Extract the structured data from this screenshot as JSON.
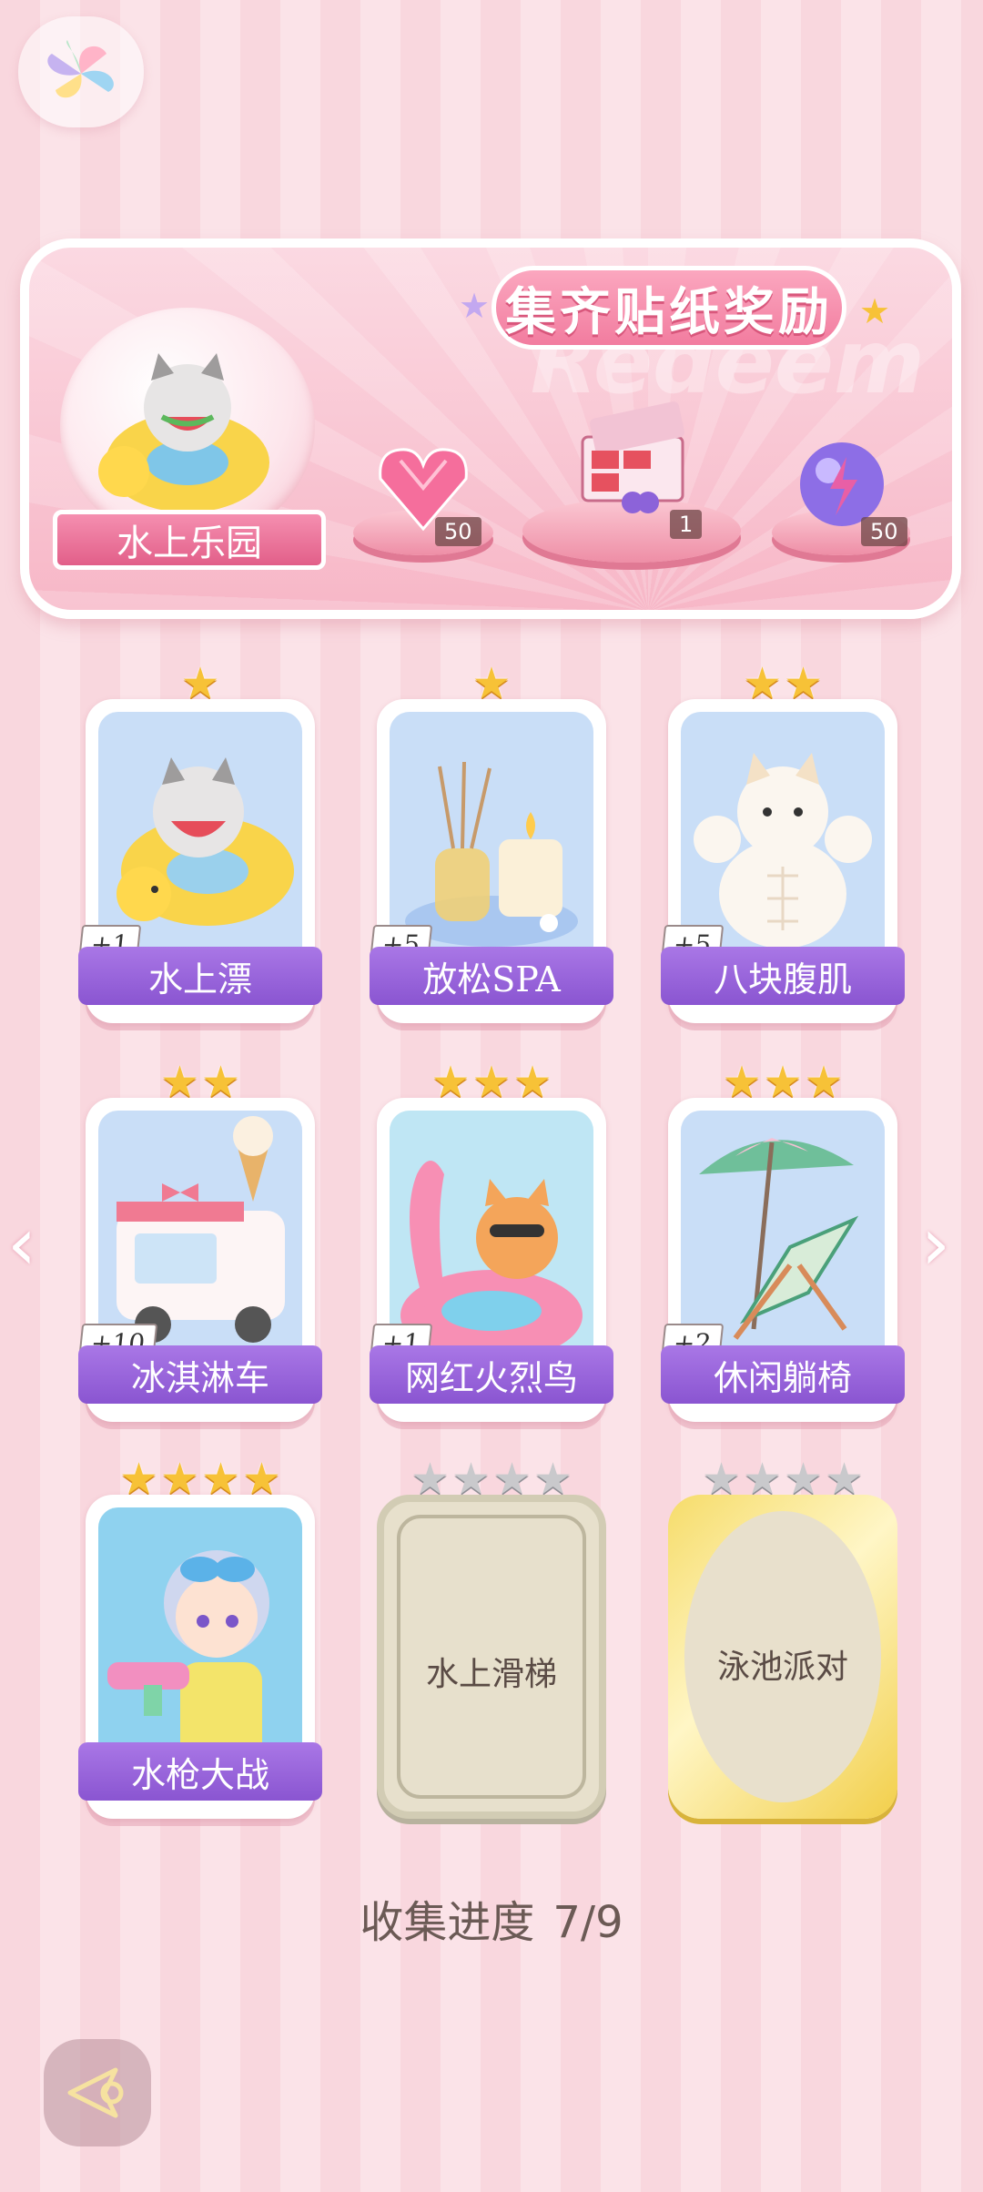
{
  "banner": {
    "title": "集齐贴纸奖励",
    "watermark": "Redeem",
    "album_name": "水上乐园",
    "rewards": [
      {
        "icon": "pink-diamond-heart-icon",
        "count": "50"
      },
      {
        "icon": "gift-box-icon",
        "count": "1"
      },
      {
        "icon": "energy-orb-icon",
        "count": "50"
      }
    ]
  },
  "stickers": [
    {
      "name": "水上漂",
      "stars": 1,
      "bonus": "+1",
      "collected": true
    },
    {
      "name": "放松SPA",
      "stars": 1,
      "bonus": "+5",
      "collected": true
    },
    {
      "name": "八块腹肌",
      "stars": 2,
      "bonus": "+5",
      "collected": true
    },
    {
      "name": "冰淇淋车",
      "stars": 2,
      "bonus": "+10",
      "collected": true
    },
    {
      "name": "网红火烈鸟",
      "stars": 3,
      "bonus": "+1",
      "collected": true
    },
    {
      "name": "休闲躺椅",
      "stars": 3,
      "bonus": "+2",
      "collected": true
    },
    {
      "name": "水枪大战",
      "stars": 4,
      "bonus": "",
      "collected": true
    },
    {
      "name": "水上滑梯",
      "stars": 4,
      "bonus": "",
      "collected": false
    },
    {
      "name": "泳池派对",
      "stars": 4,
      "bonus": "",
      "collected": false
    }
  ],
  "progress": {
    "label": "收集进度",
    "value": "7/9"
  },
  "nav": {
    "prev": "‹",
    "next": "›"
  },
  "colors": {
    "accent_purple": "#8a55d1",
    "star_gold": "#f7c237",
    "pink": "#f27c9f"
  }
}
